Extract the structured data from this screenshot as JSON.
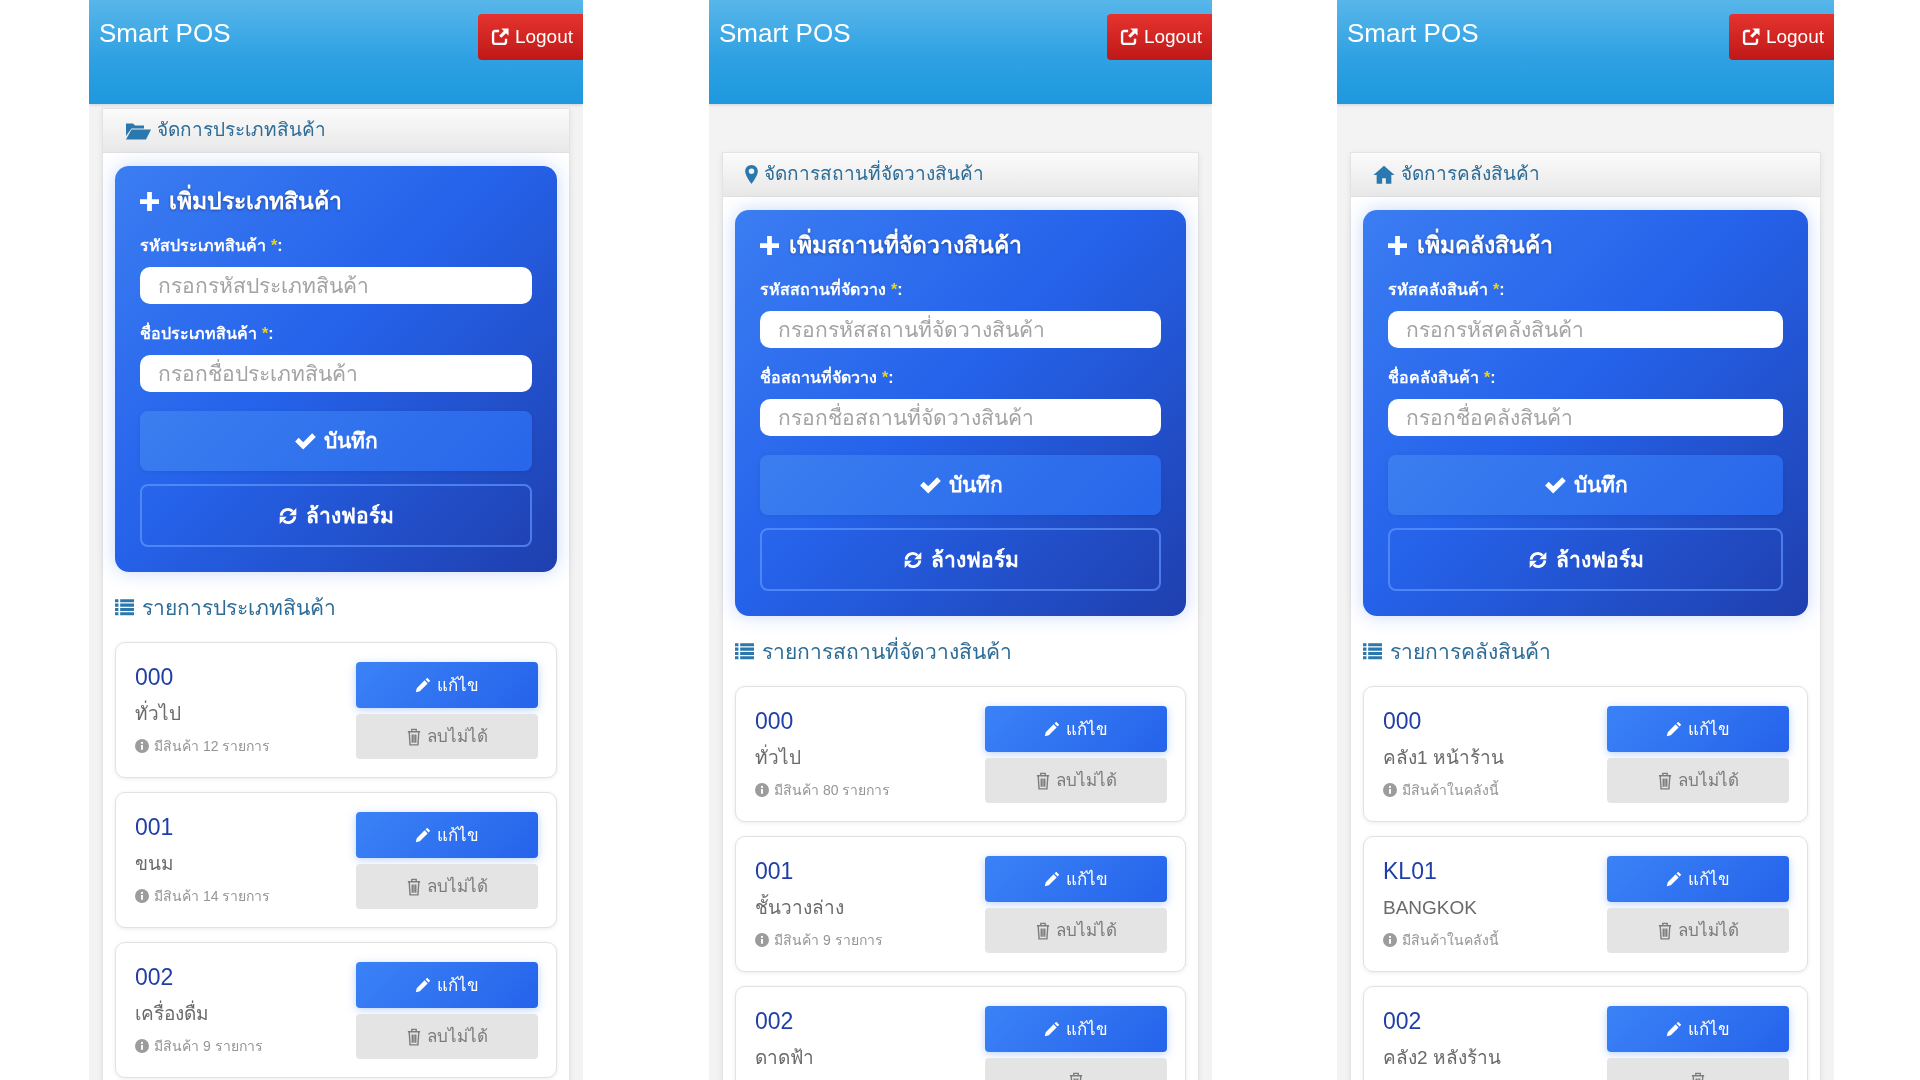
{
  "screens": [
    {
      "kind": "category",
      "app_title": "Smart POS",
      "logout_label": "Logout",
      "page_title": "จัดการประเภทสินค้า",
      "form": {
        "title": "เพิ่มประเภทสินค้า",
        "fields": [
          {
            "label": "รหัสประเภทสินค้า",
            "required_mark": "*",
            "label_suffix": ":",
            "placeholder": "กรอกรหัสประเภทสินค้า"
          },
          {
            "label": "ชื่อประเภทสินค้า",
            "required_mark": "*",
            "label_suffix": ":",
            "placeholder": "กรอกชื่อประเภทสินค้า"
          }
        ],
        "save_label": "บันทึก",
        "reset_label": "ล้างฟอร์ม"
      },
      "list_title": "รายการประเภทสินค้า",
      "items": [
        {
          "code": "000",
          "name": "ทั่วไป",
          "info": "มีสินค้า 12 รายการ",
          "edit_label": "แก้ไข",
          "delete_label": "ลบไม่ได้",
          "delete_disabled": true
        },
        {
          "code": "001",
          "name": "ขนม",
          "info": "มีสินค้า 14 รายการ",
          "edit_label": "แก้ไข",
          "delete_label": "ลบไม่ได้",
          "delete_disabled": true
        },
        {
          "code": "002",
          "name": "เครื่องดื่ม",
          "info": "มีสินค้า 9 รายการ",
          "edit_label": "แก้ไข",
          "delete_label": "ลบไม่ได้",
          "delete_disabled": true
        }
      ]
    },
    {
      "kind": "location",
      "app_title": "Smart POS",
      "logout_label": "Logout",
      "page_title": "จัดการสถานที่จัดวางสินค้า",
      "form": {
        "title": "เพิ่มสถานที่จัดวางสินค้า",
        "fields": [
          {
            "label": "รหัสสถานที่จัดวาง",
            "required_mark": "*",
            "label_suffix": ":",
            "placeholder": "กรอกรหัสสถานที่จัดวางสินค้า"
          },
          {
            "label": "ชื่อสถานที่จัดวาง",
            "required_mark": "*",
            "label_suffix": ":",
            "placeholder": "กรอกชื่อสถานที่จัดวางสินค้า"
          }
        ],
        "save_label": "บันทึก",
        "reset_label": "ล้างฟอร์ม"
      },
      "list_title": "รายการสถานที่จัดวางสินค้า",
      "items": [
        {
          "code": "000",
          "name": "ทั่วไป",
          "info": "มีสินค้า 80 รายการ",
          "edit_label": "แก้ไข",
          "delete_label": "ลบไม่ได้",
          "delete_disabled": true
        },
        {
          "code": "001",
          "name": "ชั้นวางล่าง",
          "info": "มีสินค้า 9 รายการ",
          "edit_label": "แก้ไข",
          "delete_label": "ลบไม่ได้",
          "delete_disabled": true
        },
        {
          "code": "002",
          "name": "ดาดฟ้า",
          "edit_label": "แก้ไข",
          "delete_disabled": true
        }
      ]
    },
    {
      "kind": "warehouse",
      "app_title": "Smart POS",
      "logout_label": "Logout",
      "page_title": "จัดการคลังสินค้า",
      "form": {
        "title": "เพิ่มคลังสินค้า",
        "fields": [
          {
            "label": "รหัสคลังสินค้า",
            "required_mark": "*",
            "label_suffix": ":",
            "placeholder": "กรอกรหัสคลังสินค้า"
          },
          {
            "label": "ชื่อคลังสินค้า",
            "required_mark": "*",
            "label_suffix": ":",
            "placeholder": "กรอกชื่อคลังสินค้า"
          }
        ],
        "save_label": "บันทึก",
        "reset_label": "ล้างฟอร์ม"
      },
      "list_title": "รายการคลังสินค้า",
      "items": [
        {
          "code": "000",
          "name": "คลัง1 หน้าร้าน",
          "info": "มีสินค้าในคลังนี้",
          "edit_label": "แก้ไข",
          "delete_label": "ลบไม่ได้",
          "delete_disabled": true
        },
        {
          "code": "KL01",
          "name": "BANGKOK",
          "info": "มีสินค้าในคลังนี้",
          "edit_label": "แก้ไข",
          "delete_label": "ลบไม่ได้",
          "delete_disabled": true
        },
        {
          "code": "002",
          "name": "คลัง2 หลังร้าน",
          "edit_label": "แก้ไข",
          "delete_disabled": true
        }
      ]
    }
  ]
}
